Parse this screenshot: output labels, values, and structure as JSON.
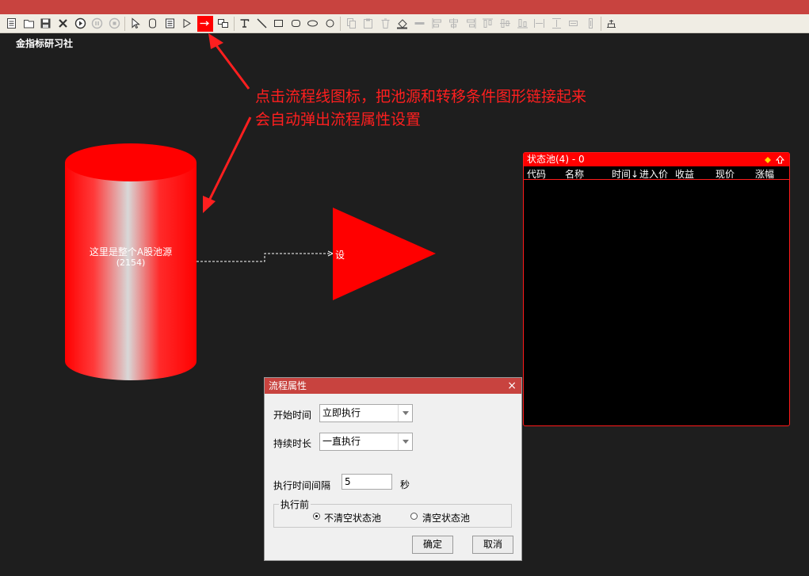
{
  "brand": "金指标研习社",
  "annotation": {
    "line1": "点击流程线图标，把池源和转移条件图形链接起来",
    "line2": "会自动弹出流程属性设置"
  },
  "pool_source": {
    "label": "这里是整个A股池源",
    "count": "(2154)"
  },
  "condition_node": {
    "label": "设"
  },
  "state_pool": {
    "title": "状态池(4) - 0",
    "columns": [
      "代码",
      "名称",
      "时间↓",
      "进入价",
      "收益",
      "现价",
      "涨幅"
    ]
  },
  "dialog": {
    "title": "流程属性",
    "close": "×",
    "start_time_label": "开始时间",
    "start_time_value": "立即执行",
    "duration_label": "持续时长",
    "duration_value": "一直执行",
    "interval_label": "执行时间间隔",
    "interval_value": "5",
    "interval_unit": "秒",
    "group_label": "执行前",
    "option_keep": "不清空状态池",
    "option_clear": "清空状态池",
    "ok": "确定",
    "cancel": "取消"
  },
  "colors": {
    "accent": "#ff0000",
    "titlebar": "#c8433f",
    "canvas": "#1e1e1e",
    "annotation": "#ff1f1f"
  },
  "toolbar_icons": [
    "new-doc-icon",
    "open-folder-icon",
    "save-icon",
    "delete-icon",
    "run-icon",
    "pause-icon",
    "stop-icon",
    "pointer-icon",
    "state-node-icon",
    "pool-icon",
    "condition-icon",
    "flow-line-icon",
    "group-icon",
    "text-icon",
    "line-icon",
    "rect-icon",
    "round-rect-icon",
    "ellipse-icon",
    "circle-icon",
    "copy-icon",
    "paste-icon",
    "trash-icon",
    "fill-icon",
    "line-style-icon",
    "align-left-icon",
    "align-center-icon",
    "align-right-icon",
    "align-top-icon",
    "align-middle-icon",
    "align-bottom-icon",
    "same-width-icon",
    "same-height-icon",
    "same-size-icon",
    "layout-icon"
  ]
}
